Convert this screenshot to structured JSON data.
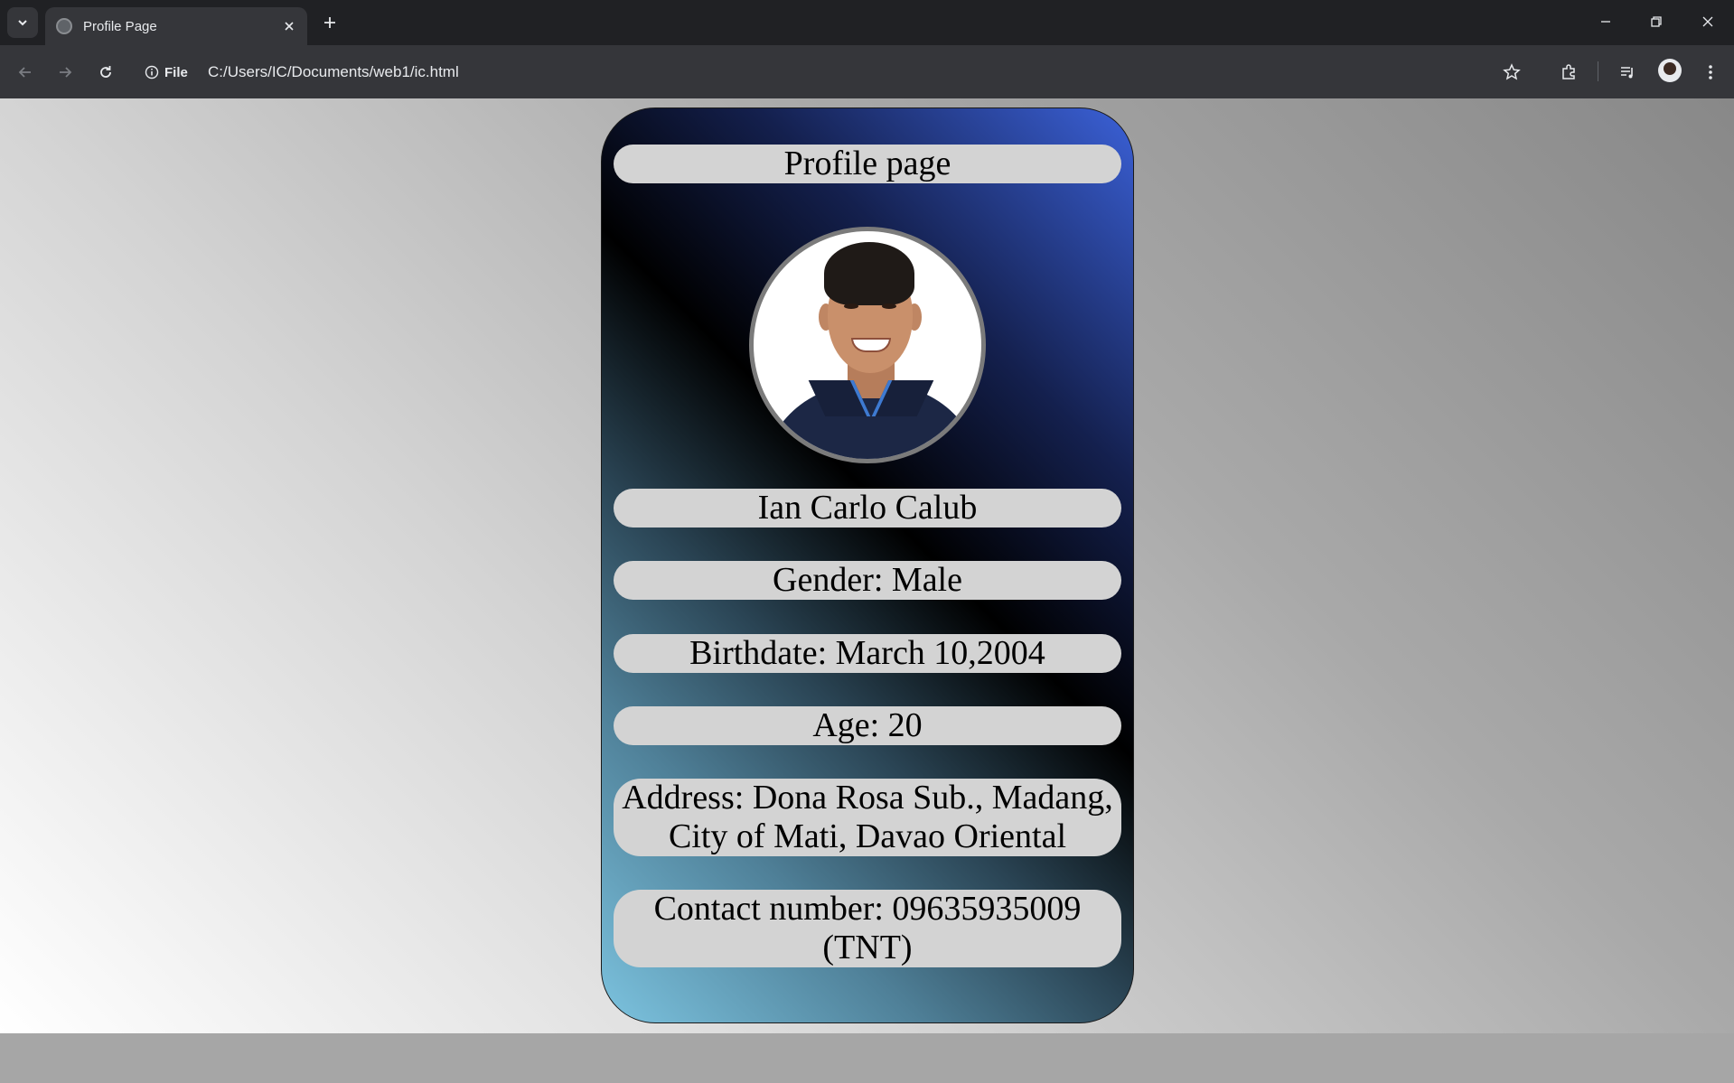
{
  "browser": {
    "tab_title": "Profile Page",
    "site_info_label": "File",
    "url": "C:/Users/IC/Documents/web1/ic.html"
  },
  "profile": {
    "heading": "Profile page",
    "name": "Ian Carlo Calub",
    "gender": "Gender: Male",
    "birthdate": "Birthdate: March 10,2004",
    "age": "Age: 20",
    "address": "Address: Dona Rosa Sub., Madang, City of Mati, Davao Oriental",
    "contact": "Contact number: 09635935009 (TNT)"
  },
  "colors": {
    "card_gradient": [
      "#3b61d8",
      "#14204e",
      "#000000",
      "#2a4454",
      "#7cc3df"
    ],
    "pill_background": "#d3d3d3",
    "photo_border": "#7b7b7b"
  }
}
